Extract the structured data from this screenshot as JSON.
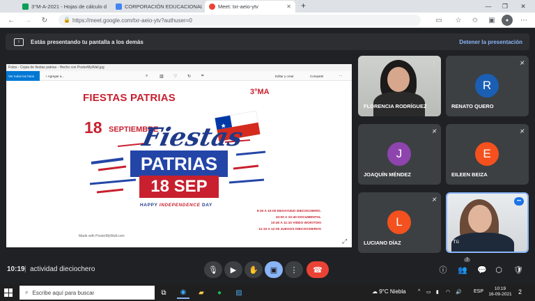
{
  "browser": {
    "tabs": [
      {
        "title": "3°M-A-2021 - Hojas de cálculo d",
        "color": "#0f9d58"
      },
      {
        "title": "CORPORACIÓN EDUCACIONAL",
        "color": "#4285f4"
      },
      {
        "title": "Meet: txr-aeio-ytv",
        "color": "#ea4335"
      }
    ],
    "new_tab": "+",
    "url": "https://meet.google.com/txr-aeio-ytv?authuser=0"
  },
  "banner": {
    "text": "Estás presentando tu pantalla a los demás",
    "stop": "Detener la presentación"
  },
  "photos_app": {
    "title": "Fotos - Copia de fiestas patrias - Hecho con PosterMyWall.jpg",
    "back": "Ver todas las fotos",
    "add": "+ Agregar a...",
    "edit": "Editar y crear",
    "share": "Compartir"
  },
  "flyer": {
    "heading": "FIESTAS PATRIAS",
    "class": "3°MA",
    "day": "18",
    "month": "SEPTIEMBRE",
    "script": "Fiestas",
    "patrias": "PATRIAS",
    "date": "18 SEP",
    "happy_a": "HAPPY ",
    "happy_b": "INDEPENDENCE",
    "happy_c": " DAY",
    "schedule": [
      "9:30 A 10:00 DESAYUNO DIECIOCHERO.",
      "10:00 A 10:40 DOCUMENTAL",
      "10:40 A 11:10 VIDEO WOKITOKI",
      "11:10 A 12:00 JUEGOS DIECIOCHEROS"
    ],
    "credit": "Made with PosterMyWall.com"
  },
  "participants": [
    {
      "name": "FLORENCIA RODRÍGUEZ",
      "video": true
    },
    {
      "name": "RENATO QUERO",
      "initial": "R",
      "color": "#1a5fb4"
    },
    {
      "name": "JOAQUÍN MÉNDEZ",
      "initial": "J",
      "color": "#8e44ad"
    },
    {
      "name": "EILEEN BEIZA",
      "initial": "E",
      "color": "#f4511e"
    },
    {
      "name": "LUCIANO DÍAZ",
      "initial": "L",
      "color": "#f4511e"
    },
    {
      "name": "Tú",
      "video": true,
      "self": true
    }
  ],
  "meeting": {
    "time": "10:19",
    "separator": "|",
    "title": "actividad dieciochero",
    "people_count": "7"
  },
  "taskbar": {
    "search_placeholder": "Escribe aquí para buscar",
    "weather": "9°C Niebla",
    "lang": "ESP",
    "time": "10:19",
    "date": "16-09-2021",
    "notifications": "2"
  }
}
